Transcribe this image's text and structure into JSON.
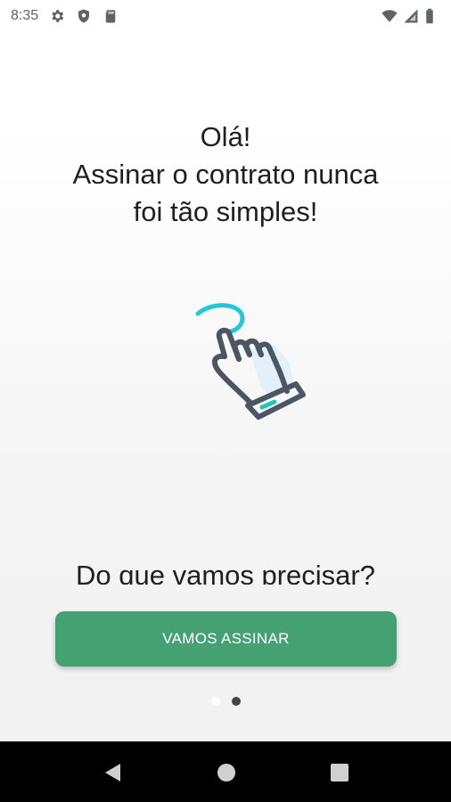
{
  "status_bar": {
    "time": "8:35",
    "left_icons": [
      "gear-icon",
      "shield-icon",
      "sd-card-icon"
    ],
    "right_icons": [
      "wifi-icon",
      "signal-icon",
      "battery-icon"
    ]
  },
  "hero": {
    "line1": "Olá!",
    "line2": "Assinar o contrato nunca",
    "line3": "foi tão simples!",
    "illustration": "tap-hand-icon",
    "colors": {
      "accent": "#26c6da",
      "outline": "#4b5563",
      "fill": "#e3f0fb",
      "cuff_accent": "#20c5b8"
    }
  },
  "section": {
    "title": "Do que vamos precisar?"
  },
  "primary_button": {
    "label": "VAMOS ASSINAR",
    "color": "#46a172"
  },
  "pager": {
    "page_count": 2,
    "active_index": 1
  },
  "nav_bar": {
    "items": [
      "back-icon",
      "home-icon",
      "recents-icon"
    ]
  }
}
